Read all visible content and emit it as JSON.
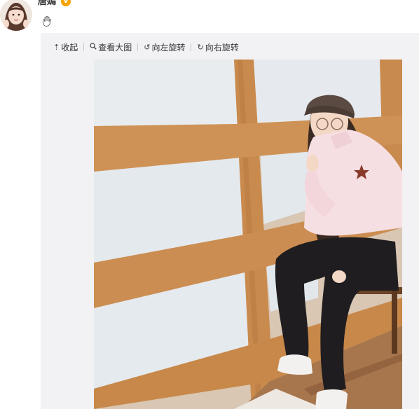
{
  "post": {
    "username": "唐嫣",
    "verified_icon": "verified-badge-icon",
    "verified_glyph": "V",
    "emoji_icon": "waving-hand-icon"
  },
  "toolbar": {
    "collapse_label": "收起",
    "collapse_icon": "arrow-up-icon",
    "view_large_label": "查看大图",
    "view_large_icon": "magnifier-icon",
    "rotate_left_label": "向左旋转",
    "rotate_left_icon": "rotate-left-icon",
    "rotate_right_label": "向右旋转",
    "rotate_right_icon": "rotate-right-icon"
  },
  "colors": {
    "panel_bg": "#f2f2f5",
    "badge": "#f5a300",
    "wood": "#c98a4e",
    "frosted_glass": "#e6eaee"
  }
}
